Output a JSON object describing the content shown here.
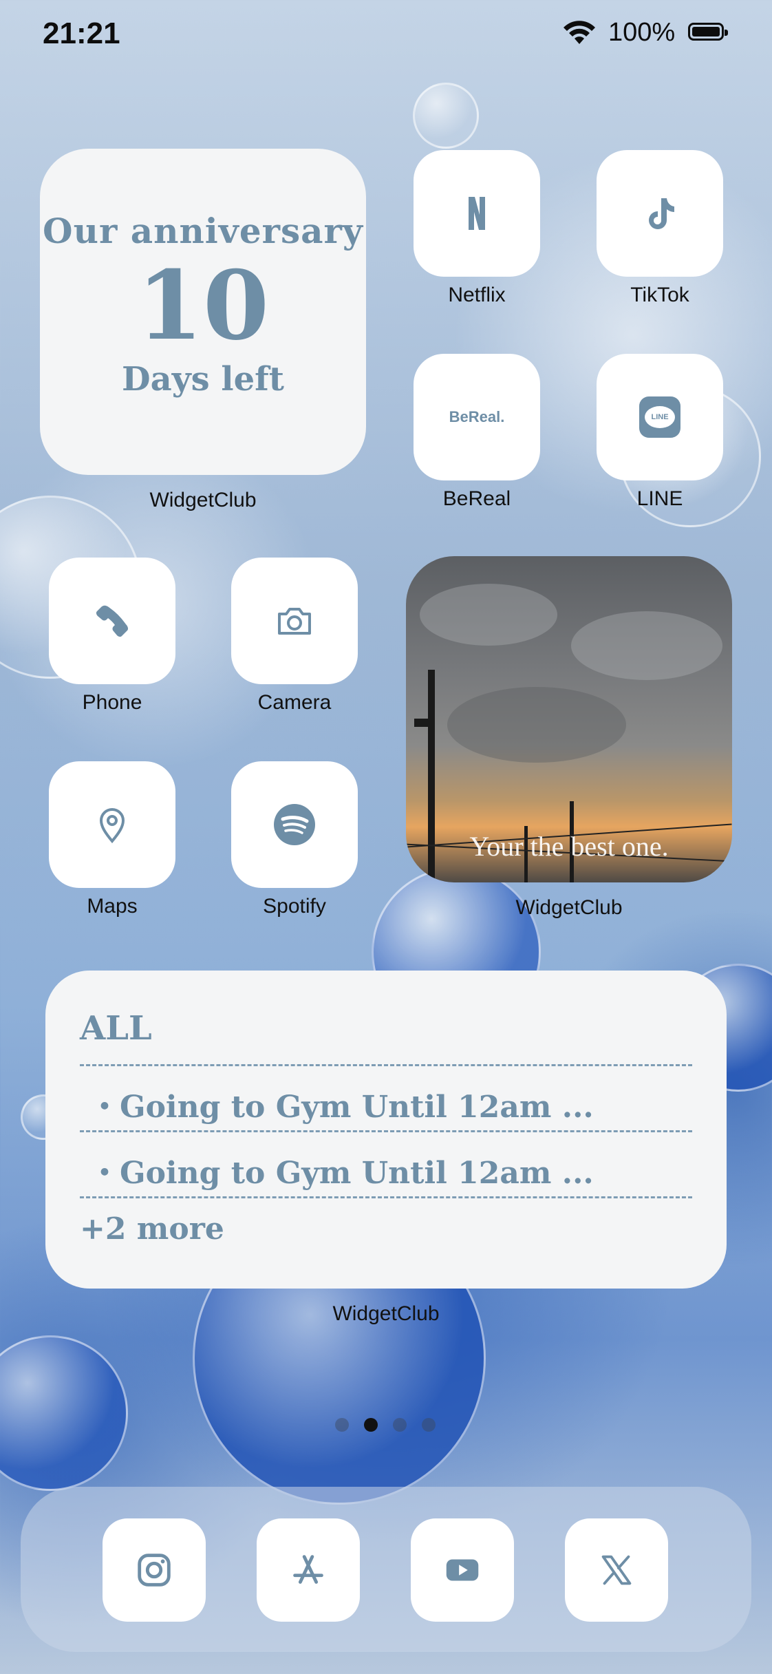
{
  "status_bar": {
    "time": "21:21",
    "battery_percent": "100%"
  },
  "home": {
    "apps": [
      {
        "label": "Netflix",
        "icon": "netflix-icon"
      },
      {
        "label": "TikTok",
        "icon": "tiktok-icon"
      },
      {
        "label": "BeReal",
        "icon": "bereal-icon",
        "icon_text": "BeReal."
      },
      {
        "label": "LINE",
        "icon": "line-icon",
        "icon_text": "LINE"
      },
      {
        "label": "Phone",
        "icon": "phone-icon"
      },
      {
        "label": "Camera",
        "icon": "camera-icon"
      },
      {
        "label": "Maps",
        "icon": "map-pin-icon"
      },
      {
        "label": "Spotify",
        "icon": "spotify-icon"
      }
    ],
    "anniversary_widget": {
      "title": "Our anniversary",
      "count": "10",
      "subtitle": "Days left",
      "label": "WidgetClub"
    },
    "photo_widget": {
      "caption": "Your the best one.",
      "label": "WidgetClub"
    },
    "todo_widget": {
      "title": "ALL",
      "items": [
        "・Going to Gym Until 12am ...",
        "・Going to Gym Until 12am ..."
      ],
      "more": "+2 more",
      "label": "WidgetClub"
    },
    "page_dots": {
      "count": 4,
      "active_index": 1
    }
  },
  "dock": {
    "apps": [
      {
        "icon": "instagram-icon"
      },
      {
        "icon": "app-store-icon"
      },
      {
        "icon": "youtube-icon"
      },
      {
        "icon": "x-icon"
      }
    ]
  },
  "colors": {
    "accent": "#6e8ea6",
    "tile": "#ffffff",
    "widget_bg": "#f4f5f6"
  }
}
